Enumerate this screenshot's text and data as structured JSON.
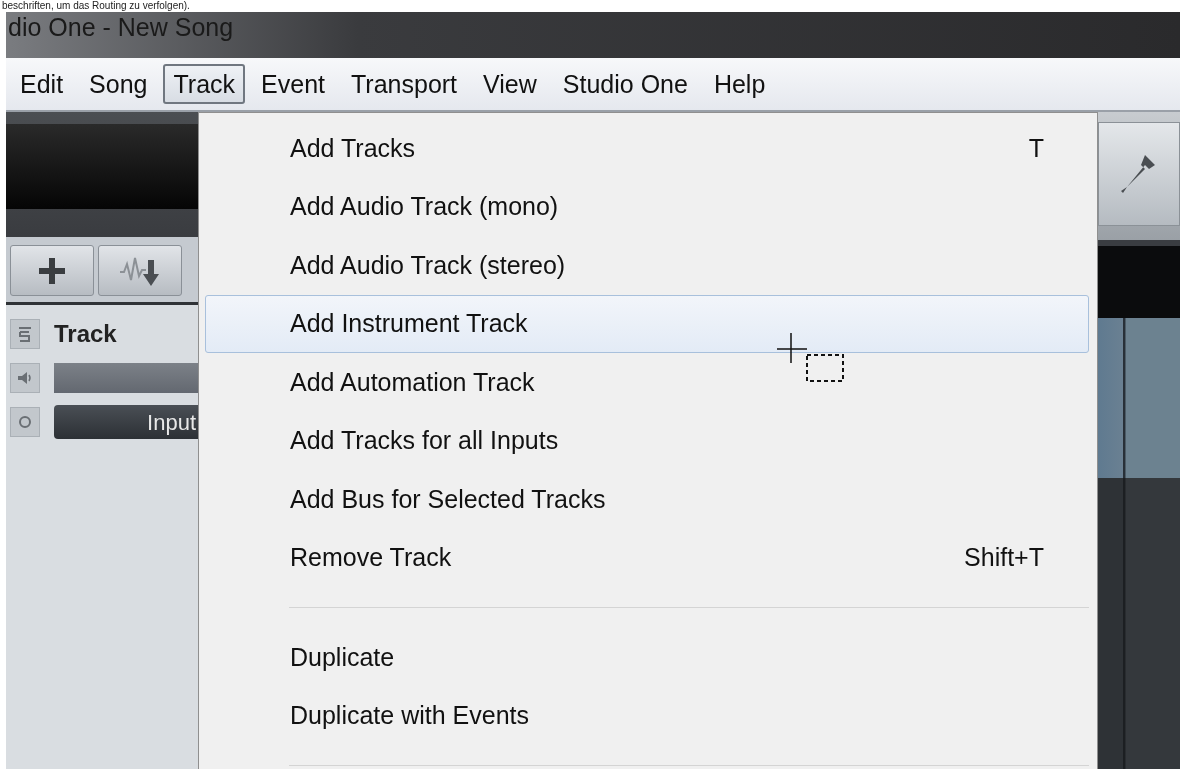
{
  "caption": "beschriften, um das Routing zu verfolgen).",
  "window": {
    "title": "dio One - New Song"
  },
  "menubar": [
    {
      "label": "Edit",
      "selected": false
    },
    {
      "label": "Song",
      "selected": false
    },
    {
      "label": "Track",
      "selected": true
    },
    {
      "label": "Event",
      "selected": false
    },
    {
      "label": "Transport",
      "selected": false
    },
    {
      "label": "View",
      "selected": false
    },
    {
      "label": "Studio One",
      "selected": false
    },
    {
      "label": "Help",
      "selected": false
    }
  ],
  "menu": [
    {
      "kind": "item",
      "label": "Add Tracks",
      "shortcut": "T",
      "selected": false
    },
    {
      "kind": "item",
      "label": "Add Audio Track (mono)",
      "selected": false
    },
    {
      "kind": "item",
      "label": "Add Audio Track (stereo)",
      "selected": false
    },
    {
      "kind": "item",
      "label": "Add Instrument Track",
      "selected": true
    },
    {
      "kind": "item",
      "label": "Add Automation Track",
      "selected": false
    },
    {
      "kind": "item",
      "label": "Add Tracks for all Inputs",
      "selected": false
    },
    {
      "kind": "item",
      "label": "Add Bus for Selected Tracks",
      "selected": false
    },
    {
      "kind": "item",
      "label": "Remove Track",
      "shortcut": "Shift+T",
      "selected": false
    },
    {
      "kind": "separator"
    },
    {
      "kind": "item",
      "label": "Duplicate",
      "selected": false
    },
    {
      "kind": "item",
      "label": "Duplicate with Events",
      "selected": false
    },
    {
      "kind": "separator"
    }
  ],
  "track": {
    "name": "Track",
    "input": "Input"
  }
}
